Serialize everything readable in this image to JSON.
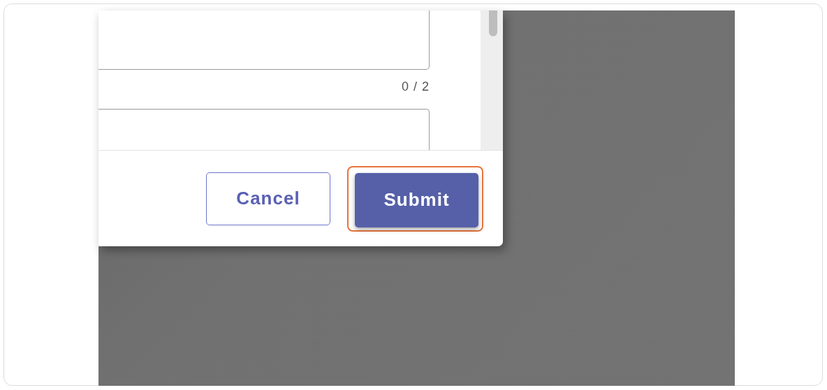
{
  "dialog": {
    "counter": "0 / 2",
    "buttons": [
      {
        "label": "Cancel",
        "kind": "outlined",
        "highlighted": false
      },
      {
        "label": "Submit",
        "kind": "filled",
        "highlighted": true
      }
    ]
  }
}
